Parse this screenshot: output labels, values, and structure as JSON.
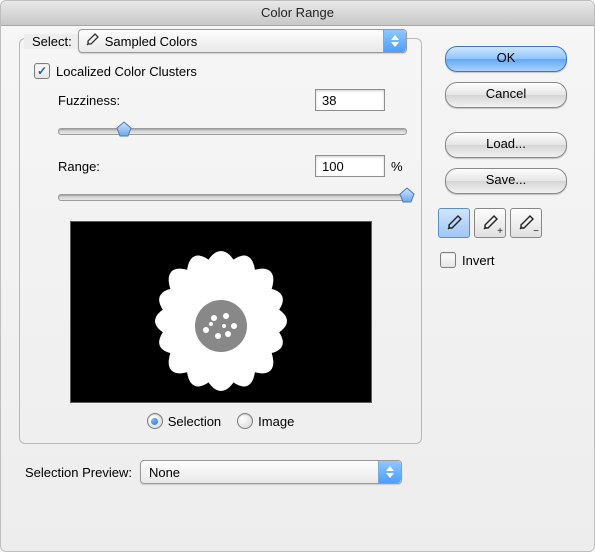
{
  "window": {
    "title": "Color Range"
  },
  "select": {
    "label": "Select:",
    "value": "Sampled Colors"
  },
  "localized_clusters": {
    "label": "Localized Color Clusters",
    "checked": true
  },
  "fuzziness": {
    "label": "Fuzziness:",
    "value": "38",
    "slider_percent": 19
  },
  "range": {
    "label": "Range:",
    "value": "100",
    "suffix": "%",
    "slider_percent": 100
  },
  "preview_mode": {
    "selection": {
      "label": "Selection",
      "checked": true
    },
    "image": {
      "label": "Image",
      "checked": false
    }
  },
  "selection_preview": {
    "label": "Selection Preview:",
    "value": "None"
  },
  "buttons": {
    "ok": "OK",
    "cancel": "Cancel",
    "load": "Load...",
    "save": "Save..."
  },
  "tools": {
    "eyedropper": "eyedropper",
    "eyedropper_add": "eyedropper-add",
    "eyedropper_sub": "eyedropper-subtract"
  },
  "invert": {
    "label": "Invert",
    "checked": false
  }
}
